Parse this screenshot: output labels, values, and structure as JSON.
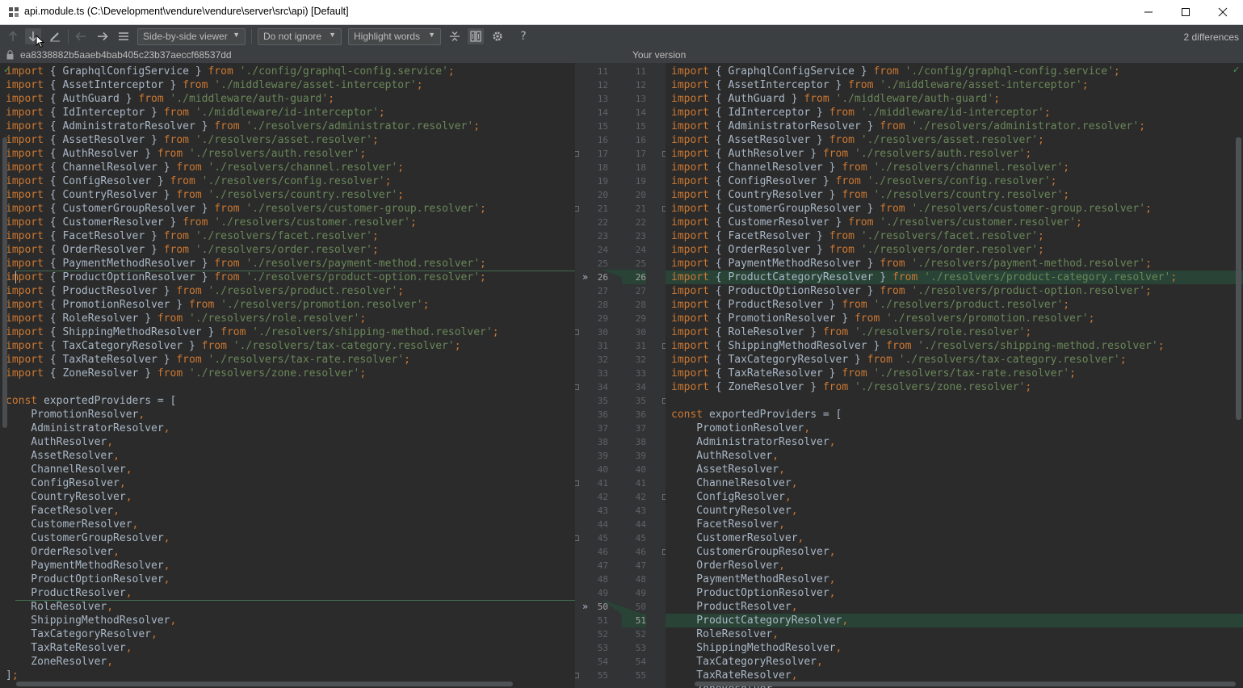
{
  "window": {
    "title": "api.module.ts (C:\\Development\\vendure\\vendure\\server\\src\\api) [Default]",
    "controls": [
      "minimize-icon",
      "maximize-icon",
      "close-icon"
    ]
  },
  "toolbar": {
    "viewer_mode": "Side-by-side viewer",
    "whitespace_mode": "Do not ignore",
    "highlight_mode": "Highlight words",
    "differences": "2 differences",
    "icons": [
      "prev-difference-icon",
      "next-difference-icon",
      "edit-icon",
      "back-icon",
      "forward-icon",
      "menu-icon",
      "collapse-unchanged-icon",
      "sync-scroll-icon",
      "settings-icon",
      "help-icon"
    ]
  },
  "info": {
    "left_revision": "ea8338882b5aaeb4bab405c23b37aeccf68537dd",
    "right_label": "Your version"
  },
  "colors": {
    "background": "#2b2b2b",
    "keyword": "#cc7832",
    "string": "#6a8759",
    "identifier": "#a9b7c6",
    "inserted": "#294436"
  },
  "left_code": [
    {
      "t": "imp",
      "id": "GraphqlConfigService",
      "path": "'./config/graphql-config.service'"
    },
    {
      "t": "imp",
      "id": "AssetInterceptor",
      "path": "'./middleware/asset-interceptor'"
    },
    {
      "t": "imp",
      "id": "AuthGuard",
      "path": "'./middleware/auth-guard'"
    },
    {
      "t": "imp",
      "id": "IdInterceptor",
      "path": "'./middleware/id-interceptor'"
    },
    {
      "t": "imp",
      "id": "AdministratorResolver",
      "path": "'./resolvers/administrator.resolver'"
    },
    {
      "t": "imp",
      "id": "AssetResolver",
      "path": "'./resolvers/asset.resolver'"
    },
    {
      "t": "imp",
      "id": "AuthResolver",
      "path": "'./resolvers/auth.resolver'"
    },
    {
      "t": "imp",
      "id": "ChannelResolver",
      "path": "'./resolvers/channel.resolver'"
    },
    {
      "t": "imp",
      "id": "ConfigResolver",
      "path": "'./resolvers/config.resolver'"
    },
    {
      "t": "imp",
      "id": "CountryResolver",
      "path": "'./resolvers/country.resolver'"
    },
    {
      "t": "imp",
      "id": "CustomerGroupResolver",
      "path": "'./resolvers/customer-group.resolver'"
    },
    {
      "t": "imp",
      "id": "CustomerResolver",
      "path": "'./resolvers/customer.resolver'"
    },
    {
      "t": "imp",
      "id": "FacetResolver",
      "path": "'./resolvers/facet.resolver'"
    },
    {
      "t": "imp",
      "id": "OrderResolver",
      "path": "'./resolvers/order.resolver'"
    },
    {
      "t": "imp",
      "id": "PaymentMethodResolver",
      "path": "'./resolvers/payment-method.resolver'"
    },
    {
      "t": "imp",
      "id": "ProductOptionResolver",
      "path": "'./resolvers/product-option.resolver'"
    },
    {
      "t": "imp",
      "id": "ProductResolver",
      "path": "'./resolvers/product.resolver'"
    },
    {
      "t": "imp",
      "id": "PromotionResolver",
      "path": "'./resolvers/promotion.resolver'"
    },
    {
      "t": "imp",
      "id": "RoleResolver",
      "path": "'./resolvers/role.resolver'"
    },
    {
      "t": "imp",
      "id": "ShippingMethodResolver",
      "path": "'./resolvers/shipping-method.resolver'"
    },
    {
      "t": "imp",
      "id": "TaxCategoryResolver",
      "path": "'./resolvers/tax-category.resolver'"
    },
    {
      "t": "imp",
      "id": "TaxRateResolver",
      "path": "'./resolvers/tax-rate.resolver'"
    },
    {
      "t": "imp",
      "id": "ZoneResolver",
      "path": "'./resolvers/zone.resolver'"
    },
    {
      "t": "blank"
    },
    {
      "t": "const",
      "kw": "const",
      "id": "exportedProviders",
      "rest": " = ["
    },
    {
      "t": "item",
      "id": "PromotionResolver"
    },
    {
      "t": "item",
      "id": "AdministratorResolver"
    },
    {
      "t": "item",
      "id": "AuthResolver"
    },
    {
      "t": "item",
      "id": "AssetResolver"
    },
    {
      "t": "item",
      "id": "ChannelResolver"
    },
    {
      "t": "item",
      "id": "ConfigResolver"
    },
    {
      "t": "item",
      "id": "CountryResolver"
    },
    {
      "t": "item",
      "id": "FacetResolver"
    },
    {
      "t": "item",
      "id": "CustomerResolver"
    },
    {
      "t": "item",
      "id": "CustomerGroupResolver"
    },
    {
      "t": "item",
      "id": "OrderResolver"
    },
    {
      "t": "item",
      "id": "PaymentMethodResolver"
    },
    {
      "t": "item",
      "id": "ProductOptionResolver"
    },
    {
      "t": "item",
      "id": "ProductResolver"
    },
    {
      "t": "item",
      "id": "RoleResolver"
    },
    {
      "t": "item",
      "id": "ShippingMethodResolver"
    },
    {
      "t": "item",
      "id": "TaxCategoryResolver"
    },
    {
      "t": "item",
      "id": "TaxRateResolver"
    },
    {
      "t": "item",
      "id": "ZoneResolver"
    },
    {
      "t": "close",
      "text": "];"
    }
  ],
  "right_code": [
    {
      "t": "imp",
      "id": "GraphqlConfigService",
      "path": "'./config/graphql-config.service'"
    },
    {
      "t": "imp",
      "id": "AssetInterceptor",
      "path": "'./middleware/asset-interceptor'"
    },
    {
      "t": "imp",
      "id": "AuthGuard",
      "path": "'./middleware/auth-guard'"
    },
    {
      "t": "imp",
      "id": "IdInterceptor",
      "path": "'./middleware/id-interceptor'"
    },
    {
      "t": "imp",
      "id": "AdministratorResolver",
      "path": "'./resolvers/administrator.resolver'"
    },
    {
      "t": "imp",
      "id": "AssetResolver",
      "path": "'./resolvers/asset.resolver'"
    },
    {
      "t": "imp",
      "id": "AuthResolver",
      "path": "'./resolvers/auth.resolver'"
    },
    {
      "t": "imp",
      "id": "ChannelResolver",
      "path": "'./resolvers/channel.resolver'"
    },
    {
      "t": "imp",
      "id": "ConfigResolver",
      "path": "'./resolvers/config.resolver'"
    },
    {
      "t": "imp",
      "id": "CountryResolver",
      "path": "'./resolvers/country.resolver'"
    },
    {
      "t": "imp",
      "id": "CustomerGroupResolver",
      "path": "'./resolvers/customer-group.resolver'"
    },
    {
      "t": "imp",
      "id": "CustomerResolver",
      "path": "'./resolvers/customer.resolver'"
    },
    {
      "t": "imp",
      "id": "FacetResolver",
      "path": "'./resolvers/facet.resolver'"
    },
    {
      "t": "imp",
      "id": "OrderResolver",
      "path": "'./resolvers/order.resolver'"
    },
    {
      "t": "imp",
      "id": "PaymentMethodResolver",
      "path": "'./resolvers/payment-method.resolver'"
    },
    {
      "t": "imp",
      "id": "ProductCategoryResolver",
      "path": "'./resolvers/product-category.resolver'",
      "changed": true
    },
    {
      "t": "imp",
      "id": "ProductOptionResolver",
      "path": "'./resolvers/product-option.resolver'"
    },
    {
      "t": "imp",
      "id": "ProductResolver",
      "path": "'./resolvers/product.resolver'"
    },
    {
      "t": "imp",
      "id": "PromotionResolver",
      "path": "'./resolvers/promotion.resolver'"
    },
    {
      "t": "imp",
      "id": "RoleResolver",
      "path": "'./resolvers/role.resolver'"
    },
    {
      "t": "imp",
      "id": "ShippingMethodResolver",
      "path": "'./resolvers/shipping-method.resolver'"
    },
    {
      "t": "imp",
      "id": "TaxCategoryResolver",
      "path": "'./resolvers/tax-category.resolver'"
    },
    {
      "t": "imp",
      "id": "TaxRateResolver",
      "path": "'./resolvers/tax-rate.resolver'"
    },
    {
      "t": "imp",
      "id": "ZoneResolver",
      "path": "'./resolvers/zone.resolver'"
    },
    {
      "t": "blank"
    },
    {
      "t": "const",
      "kw": "const",
      "id": "exportedProviders",
      "rest": " = ["
    },
    {
      "t": "item",
      "id": "PromotionResolver"
    },
    {
      "t": "item",
      "id": "AdministratorResolver"
    },
    {
      "t": "item",
      "id": "AuthResolver"
    },
    {
      "t": "item",
      "id": "AssetResolver"
    },
    {
      "t": "item",
      "id": "ChannelResolver"
    },
    {
      "t": "item",
      "id": "ConfigResolver"
    },
    {
      "t": "item",
      "id": "CountryResolver"
    },
    {
      "t": "item",
      "id": "FacetResolver"
    },
    {
      "t": "item",
      "id": "CustomerResolver"
    },
    {
      "t": "item",
      "id": "CustomerGroupResolver"
    },
    {
      "t": "item",
      "id": "OrderResolver"
    },
    {
      "t": "item",
      "id": "PaymentMethodResolver"
    },
    {
      "t": "item",
      "id": "ProductOptionResolver"
    },
    {
      "t": "item",
      "id": "ProductResolver"
    },
    {
      "t": "item",
      "id": "ProductCategoryResolver",
      "changed": true
    },
    {
      "t": "item",
      "id": "RoleResolver"
    },
    {
      "t": "item",
      "id": "ShippingMethodResolver"
    },
    {
      "t": "item",
      "id": "TaxCategoryResolver"
    },
    {
      "t": "item",
      "id": "TaxRateResolver"
    },
    {
      "t": "item",
      "id": "ZoneResolver"
    }
  ],
  "left_line_numbers": [
    "11",
    "12",
    "13",
    "14",
    "15",
    "16",
    "17",
    "18",
    "19",
    "20",
    "21",
    "22",
    "23",
    "24",
    "25",
    "26",
    "27",
    "28",
    "29",
    "30",
    "31",
    "32",
    "33",
    "34",
    "35",
    "36",
    "37",
    "38",
    "39",
    "40",
    "41",
    "42",
    "43",
    "44",
    "45",
    "46",
    "47",
    "48",
    "49",
    "50",
    "51",
    "52",
    "53",
    "54",
    "55"
  ],
  "right_line_numbers": [
    "11",
    "12",
    "13",
    "14",
    "15",
    "16",
    "17",
    "18",
    "19",
    "20",
    "21",
    "22",
    "23",
    "24",
    "25",
    "26",
    "27",
    "28",
    "29",
    "30",
    "31",
    "32",
    "33",
    "34",
    "35",
    "36",
    "37",
    "38",
    "39",
    "40",
    "41",
    "42",
    "43",
    "44",
    "45",
    "46",
    "47",
    "48",
    "49",
    "50",
    "51",
    "52",
    "53",
    "54",
    "55"
  ],
  "keywords": {
    "import": "import",
    "from": "from"
  }
}
